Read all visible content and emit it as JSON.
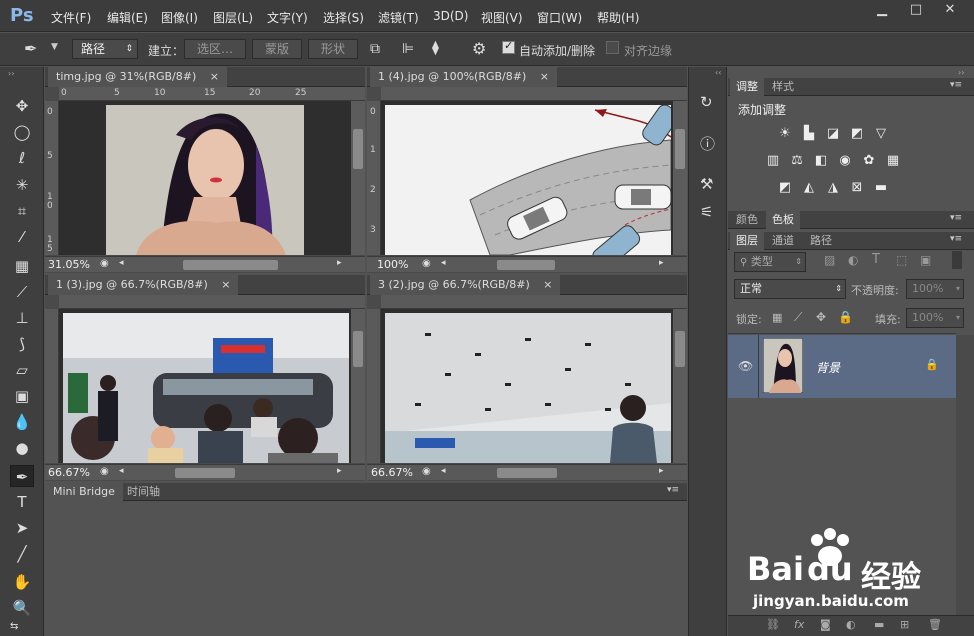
{
  "app": {
    "logo": "Ps"
  },
  "menu": [
    "文件(F)",
    "编辑(E)",
    "图像(I)",
    "图层(L)",
    "文字(Y)",
    "选择(S)",
    "滤镜(T)",
    "3D(D)",
    "视图(V)",
    "窗口(W)",
    "帮助(H)"
  ],
  "window_controls": {
    "minimize": "▁",
    "maximize": "□",
    "close": "✕"
  },
  "options": {
    "mode": "路径",
    "build_label": "建立：",
    "selection_btn": "选区…",
    "mask_btn": "蒙版",
    "shape_btn": "形状",
    "auto_add_delete": "自动添加/删除",
    "align_edges": "对齐边缘"
  },
  "documents": [
    {
      "title": "timg.jpg @ 31%(RGB/8#)",
      "zoom": "31.05%",
      "ruler_h": [
        "0",
        "5",
        "10",
        "15",
        "20",
        "25"
      ],
      "ruler_v": [
        "0",
        "5",
        "1 0",
        "1 5"
      ]
    },
    {
      "title": "1 (4).jpg @ 100%(RGB/8#)",
      "zoom": "100%",
      "ruler_h": [],
      "ruler_v": [
        "0",
        "1",
        "2",
        "3"
      ]
    },
    {
      "title": "1 (3).jpg @ 66.7%(RGB/8#)",
      "zoom": "66.67%"
    },
    {
      "title": "3 (2).jpg @ 66.7%(RGB/8#)",
      "zoom": "66.67%"
    }
  ],
  "bottom_tabs": [
    "Mini Bridge",
    "时间轴"
  ],
  "panels": {
    "adjust_tabs": [
      "调整",
      "样式"
    ],
    "adjust_title": "添加调整",
    "swatch_tabs": [
      "颜色",
      "色板"
    ],
    "layer_tabs": [
      "图层",
      "通道",
      "路径"
    ],
    "kind_filter": "类型",
    "blend_mode": "正常",
    "opacity_label": "不透明度:",
    "opacity_value": "100%",
    "lock_label": "锁定:",
    "fill_label": "填充:",
    "fill_value": "100%",
    "layer_name": "背景"
  },
  "watermark": {
    "brand": "Bai",
    "brand2": "du",
    "cn": "经验",
    "url": "jingyan.baidu.com"
  },
  "colors": {
    "accent": "#8ab8e8",
    "selected_layer": "#5b6a85",
    "background": "#535353"
  }
}
